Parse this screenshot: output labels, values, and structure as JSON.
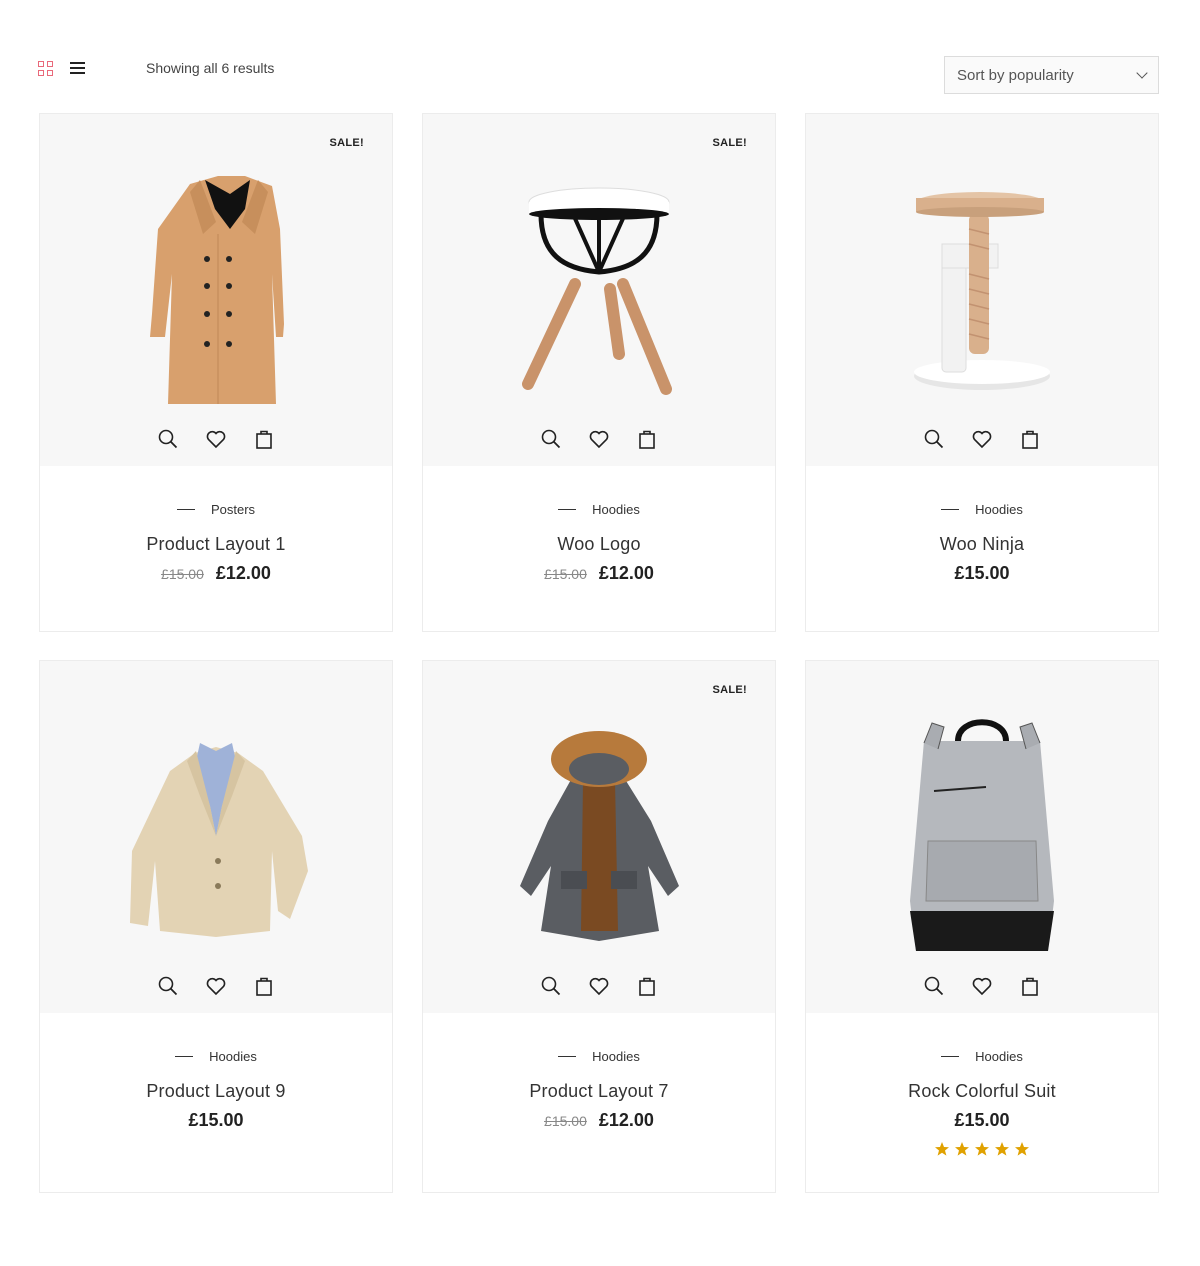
{
  "toolbar": {
    "results_text": "Showing all 6 results",
    "sort_label": "Sort by popularity",
    "accent_color": "#e9697a"
  },
  "products": [
    {
      "sale": "SALE!",
      "category": "Posters",
      "title": "Product Layout 1",
      "old_price": "£15.00",
      "price": "£12.00",
      "image": "trench-coat"
    },
    {
      "sale": "SALE!",
      "category": "Hoodies",
      "title": "Woo Logo",
      "old_price": "£15.00",
      "price": "£12.00",
      "image": "stool"
    },
    {
      "sale": "",
      "category": "Hoodies",
      "title": "Woo Ninja",
      "old_price": "",
      "price": "£15.00",
      "image": "wooden-stool"
    },
    {
      "sale": "",
      "category": "Hoodies",
      "title": "Product Layout 9",
      "old_price": "",
      "price": "£15.00",
      "image": "blazer"
    },
    {
      "sale": "SALE!",
      "category": "Hoodies",
      "title": "Product Layout 7",
      "old_price": "£15.00",
      "price": "£12.00",
      "image": "parka"
    },
    {
      "sale": "",
      "category": "Hoodies",
      "title": "Rock Colorful Suit",
      "old_price": "",
      "price": "£15.00",
      "image": "backpack",
      "rating": 5
    }
  ],
  "icons": {
    "quick_view": "search-icon",
    "wishlist": "heart-icon",
    "cart": "shopping-bag-icon",
    "star_color": "#e0a100"
  }
}
